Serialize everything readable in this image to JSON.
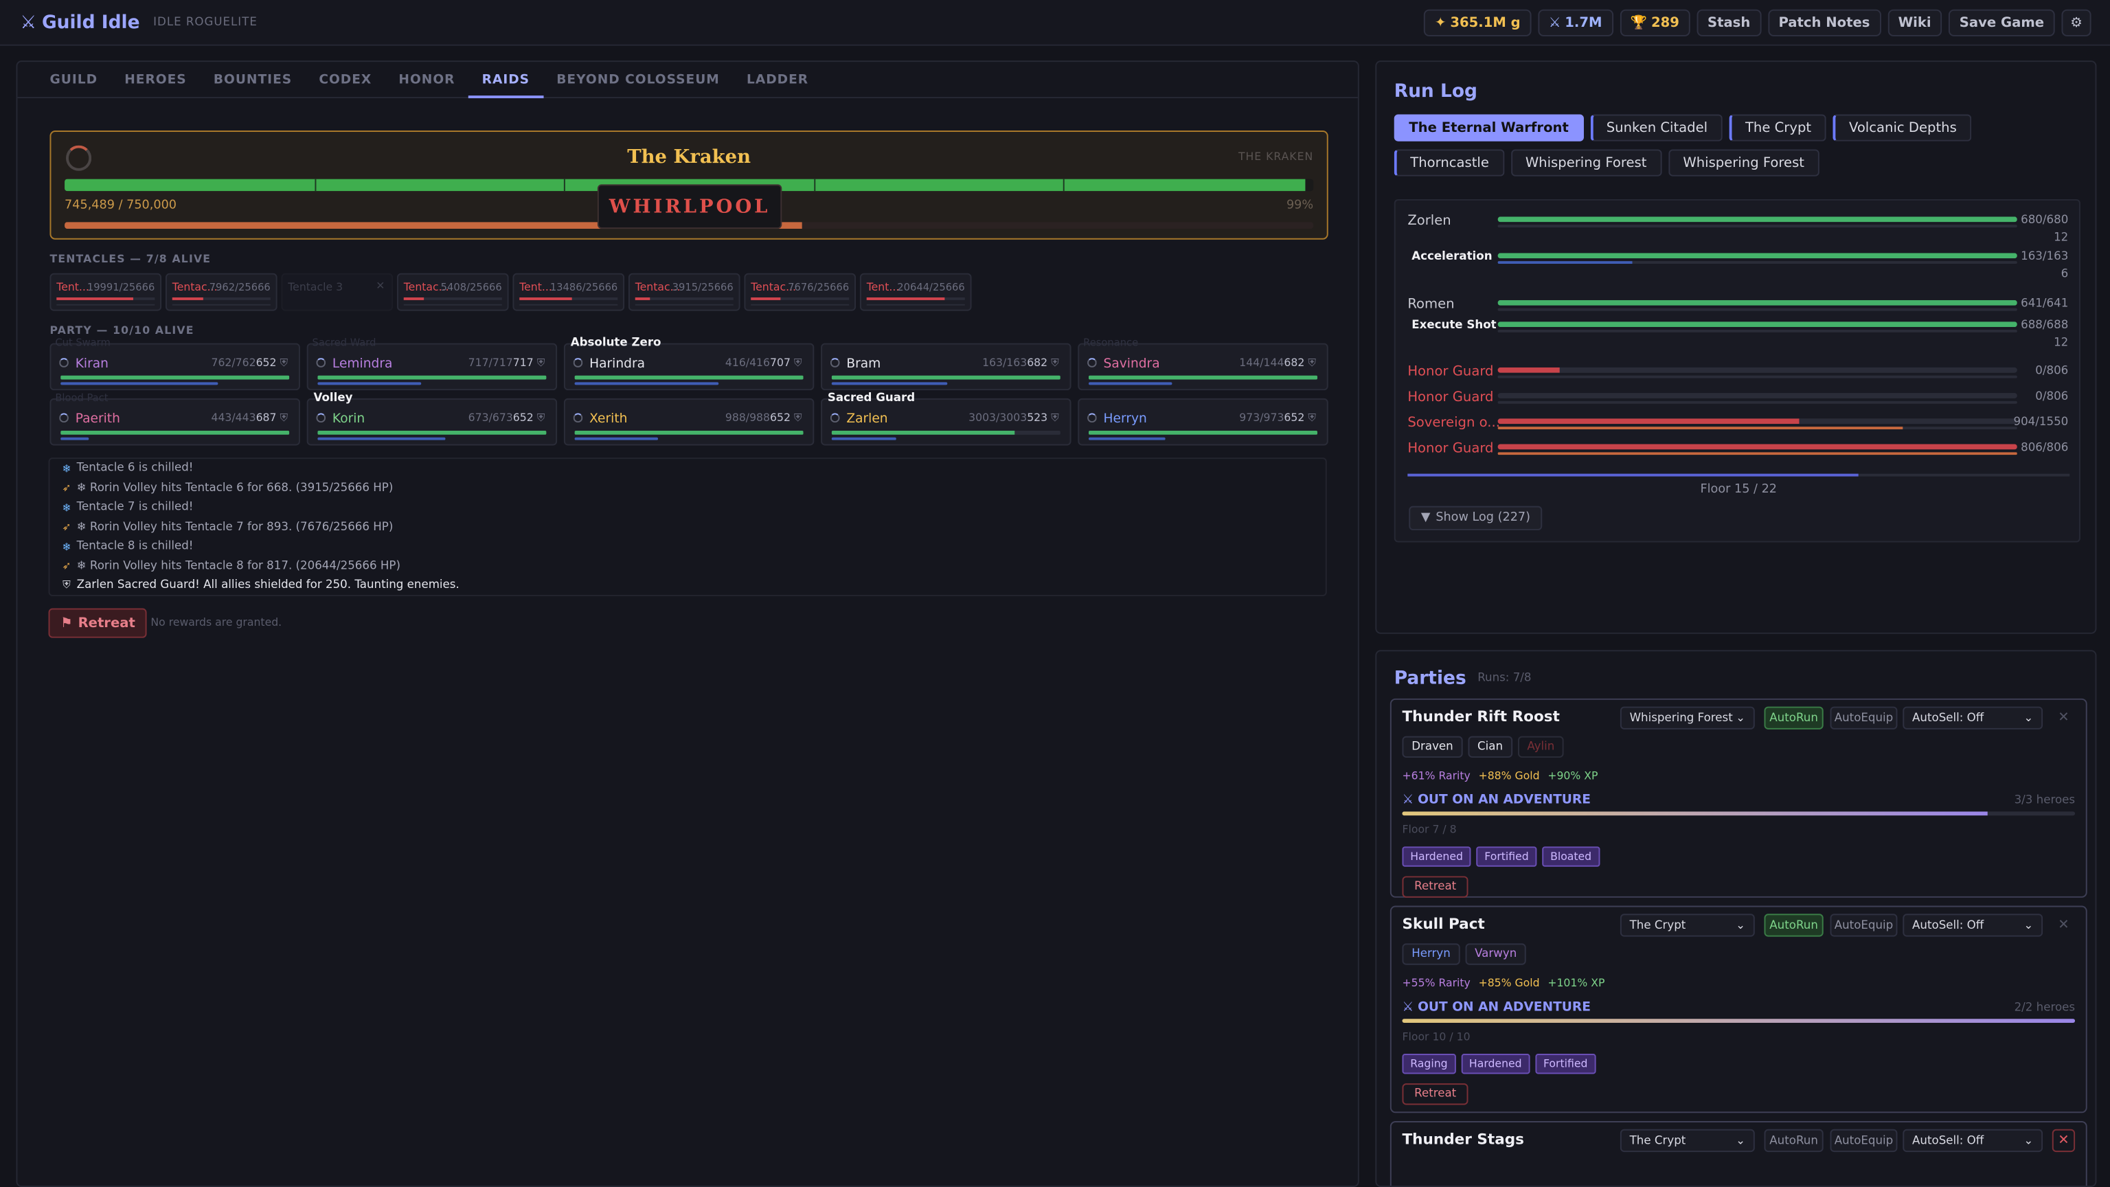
{
  "app": {
    "title": "Guild Idle",
    "subtitle": "IDLE ROGUELITE"
  },
  "topbar": {
    "gold": "365.1M g",
    "power": "1.7M",
    "trophies": "289",
    "stash": "Stash",
    "patch_notes": "Patch Notes",
    "wiki": "Wiki",
    "save": "Save Game"
  },
  "tabs": [
    "GUILD",
    "HEROES",
    "BOUNTIES",
    "CODEX",
    "HONOR",
    "RAIDS",
    "BEYOND COLOSSEUM",
    "LADDER"
  ],
  "active_tab": "RAIDS",
  "boss": {
    "name": "The Kraken",
    "tag": "THE KRAKEN",
    "hp_text": "745,489 / 750,000",
    "hp_pct_text": "99%",
    "hp_fraction": 0.994,
    "enrage_fraction": 0.59,
    "mechanic": "WHIRLPOOL"
  },
  "tentacles_label": "TENTACLES — 7/8 ALIVE",
  "tentacles": [
    {
      "name": "Tent...",
      "hp": "19991/25666",
      "fraction": 0.78,
      "alive": true
    },
    {
      "name": "Tentac...",
      "hp": "7962/25666",
      "fraction": 0.31,
      "alive": true
    },
    {
      "name": "Tentacle 3",
      "hp": "",
      "fraction": 0,
      "alive": false
    },
    {
      "name": "Tentac...",
      "hp": "5408/25666",
      "fraction": 0.21,
      "alive": true
    },
    {
      "name": "Tent...",
      "hp": "13486/25666",
      "fraction": 0.53,
      "alive": true
    },
    {
      "name": "Tentac...",
      "hp": "3915/25666",
      "fraction": 0.15,
      "alive": true
    },
    {
      "name": "Tentac...",
      "hp": "7676/25666",
      "fraction": 0.3,
      "alive": true
    },
    {
      "name": "Tent...",
      "hp": "20644/25666",
      "fraction": 0.8,
      "alive": true
    }
  ],
  "party_label": "PARTY — 10/10 ALIVE",
  "heroes": [
    {
      "name": "Kiran",
      "color": "#b87fe0",
      "hp": "762/762",
      "shield": "652",
      "ghost": "Cut Swarm",
      "ability": "",
      "hp_fraction": 1.0,
      "mana_fraction": 0.68
    },
    {
      "name": "Lemindra",
      "color": "#b87fe0",
      "hp": "717/717",
      "shield": "717",
      "ghost": "Sacred Ward",
      "ability": "",
      "hp_fraction": 1.0,
      "mana_fraction": 0.45
    },
    {
      "name": "Harindra",
      "color": "#e4e5ec",
      "hp": "416/416",
      "shield": "707",
      "ghost": "",
      "ability": "Absolute Zero",
      "hp_fraction": 1.0,
      "mana_fraction": 0.62
    },
    {
      "name": "Bram",
      "color": "#e4e5ec",
      "hp": "163/163",
      "shield": "682",
      "ghost": "",
      "ability": "",
      "hp_fraction": 1.0,
      "mana_fraction": 0.5
    },
    {
      "name": "Savindra",
      "color": "#e06fa2",
      "hp": "144/144",
      "shield": "682",
      "ghost": "Resonance",
      "ability": "",
      "hp_fraction": 1.0,
      "mana_fraction": 0.36
    },
    {
      "name": "Paerith",
      "color": "#e06fa2",
      "hp": "443/443",
      "shield": "687",
      "ghost": "Blood Pact",
      "ability": "",
      "hp_fraction": 1.0,
      "mana_fraction": 0.12
    },
    {
      "name": "Korin",
      "color": "#7ed38a",
      "hp": "673/673",
      "shield": "652",
      "ghost": "",
      "ability": "Volley",
      "hp_fraction": 1.0,
      "mana_fraction": 0.55
    },
    {
      "name": "Xerith",
      "color": "#f2c052",
      "hp": "988/988",
      "shield": "652",
      "ghost": "",
      "ability": "",
      "hp_fraction": 1.0,
      "mana_fraction": 0.36
    },
    {
      "name": "Zarlen",
      "color": "#f2c052",
      "hp": "3003/3003",
      "shield": "523",
      "ghost": "",
      "ability": "Sacred Guard",
      "hp_fraction": 0.8,
      "mana_fraction": 0.28
    },
    {
      "name": "Herryn",
      "color": "#7a9cff",
      "hp": "973/973",
      "shield": "652",
      "ghost": "",
      "ability": "",
      "hp_fraction": 1.0,
      "mana_fraction": 0.33
    }
  ],
  "log": [
    {
      "icon": "snowflake-icon",
      "text": "Tentacle 6 is chilled!"
    },
    {
      "icon": "bow-icon",
      "text": "❄ Rorin Volley hits Tentacle 6 for 668. (3915/25666 HP)"
    },
    {
      "icon": "snowflake-icon",
      "text": "Tentacle 7 is chilled!"
    },
    {
      "icon": "bow-icon",
      "text": "❄ Rorin Volley hits Tentacle 7 for 893. (7676/25666 HP)"
    },
    {
      "icon": "snowflake-icon",
      "text": "Tentacle 8 is chilled!"
    },
    {
      "icon": "bow-icon",
      "text": "❄ Rorin Volley hits Tentacle 8 for 817. (20644/25666 HP)"
    },
    {
      "icon": "shield-icon",
      "text": "Zarlen Sacred Guard! All allies shielded for 250. Taunting enemies."
    }
  ],
  "retreat": {
    "label": "Retreat",
    "note": "No rewards are granted."
  },
  "runlog": {
    "title": "Run Log",
    "zones": [
      {
        "label": "The Eternal Warfront",
        "active": true
      },
      {
        "label": "Sunken Citadel",
        "active": false
      },
      {
        "label": "The Crypt",
        "active": false
      },
      {
        "label": "Volcanic Depths",
        "active": false
      },
      {
        "label": "Thorncastle",
        "active": false
      },
      {
        "label": "Whispering Forest",
        "active": false
      },
      {
        "label": "Whispering Forest",
        "active": false
      }
    ],
    "rows": [
      {
        "name": "Zorlen",
        "value": "680/680",
        "sub": "12",
        "fraction": 1.0,
        "kind": "hero"
      },
      {
        "name": "Acceleration",
        "value": "163/163",
        "sub": "6",
        "fraction": 1.0,
        "kind": "ability"
      },
      {
        "name": "Romen",
        "value": "641/641",
        "sub": "",
        "fraction": 1.0,
        "kind": "hero"
      },
      {
        "name": "Execute Shot",
        "value": "688/688",
        "sub": "12",
        "fraction": 1.0,
        "kind": "ability"
      },
      {
        "name": "Honor Guard",
        "value": "0/806",
        "sub": "",
        "fraction": 0.12,
        "kind": "enemy"
      },
      {
        "name": "Honor Guard",
        "value": "0/806",
        "sub": "",
        "fraction": 0.0,
        "kind": "enemy"
      },
      {
        "name": "Sovereign o...",
        "value": "904/1550",
        "sub": "",
        "fraction": 0.58,
        "kind": "enemy"
      },
      {
        "name": "Honor Guard",
        "value": "806/806",
        "sub": "",
        "fraction": 1.0,
        "kind": "enemy"
      }
    ],
    "floor_text": "Floor 15 / 22",
    "floor_fraction": 0.68,
    "show_log": "Show Log (227)"
  },
  "parties": {
    "title": "Parties",
    "runs": "Runs: 7/8",
    "cards": [
      {
        "name": "Thunder Rift Roost",
        "zone": "Whispering Forest",
        "autorun": "AutoRun",
        "autorun_on": true,
        "autoequip": "AutoEquip",
        "autosell": "AutoSell: Off",
        "members": [
          {
            "name": "Draven",
            "color": "#e4e5ec"
          },
          {
            "name": "Cian",
            "color": "#e4e5ec"
          },
          {
            "name": "Aylin",
            "color": "#7a2f36"
          }
        ],
        "bonus": [
          "+61% Rarity",
          "+88% Gold",
          "+90% XP"
        ],
        "status": "OUT ON AN ADVENTURE",
        "heroes": "3/3 heroes",
        "progress": 0.87,
        "floor": "Floor 7 / 8",
        "mods": [
          "Hardened",
          "Fortified",
          "Bloated"
        ],
        "retreat": "Retreat"
      },
      {
        "name": "Skull Pact",
        "zone": "The Crypt",
        "autorun": "AutoRun",
        "autorun_on": true,
        "autoequip": "AutoEquip",
        "autosell": "AutoSell: Off",
        "members": [
          {
            "name": "Herryn",
            "color": "#7a9cff"
          },
          {
            "name": "Varwyn",
            "color": "#b87fe0"
          }
        ],
        "bonus": [
          "+55% Rarity",
          "+85% Gold",
          "+101% XP"
        ],
        "status": "OUT ON AN ADVENTURE",
        "heroes": "2/2 heroes",
        "progress": 1.0,
        "floor": "Floor 10 / 10",
        "mods": [
          "Raging",
          "Hardened",
          "Fortified"
        ],
        "retreat": "Retreat"
      },
      {
        "name": "Thunder Stags",
        "zone": "The Crypt",
        "autorun": "AutoRun",
        "autorun_on": false,
        "autoequip": "AutoEquip",
        "autosell": "AutoSell: Off"
      }
    ]
  },
  "colors": {
    "accent": "#8b93ff",
    "gold": "#f2c052",
    "danger": "#e04f55",
    "hp": "#45b36a"
  }
}
